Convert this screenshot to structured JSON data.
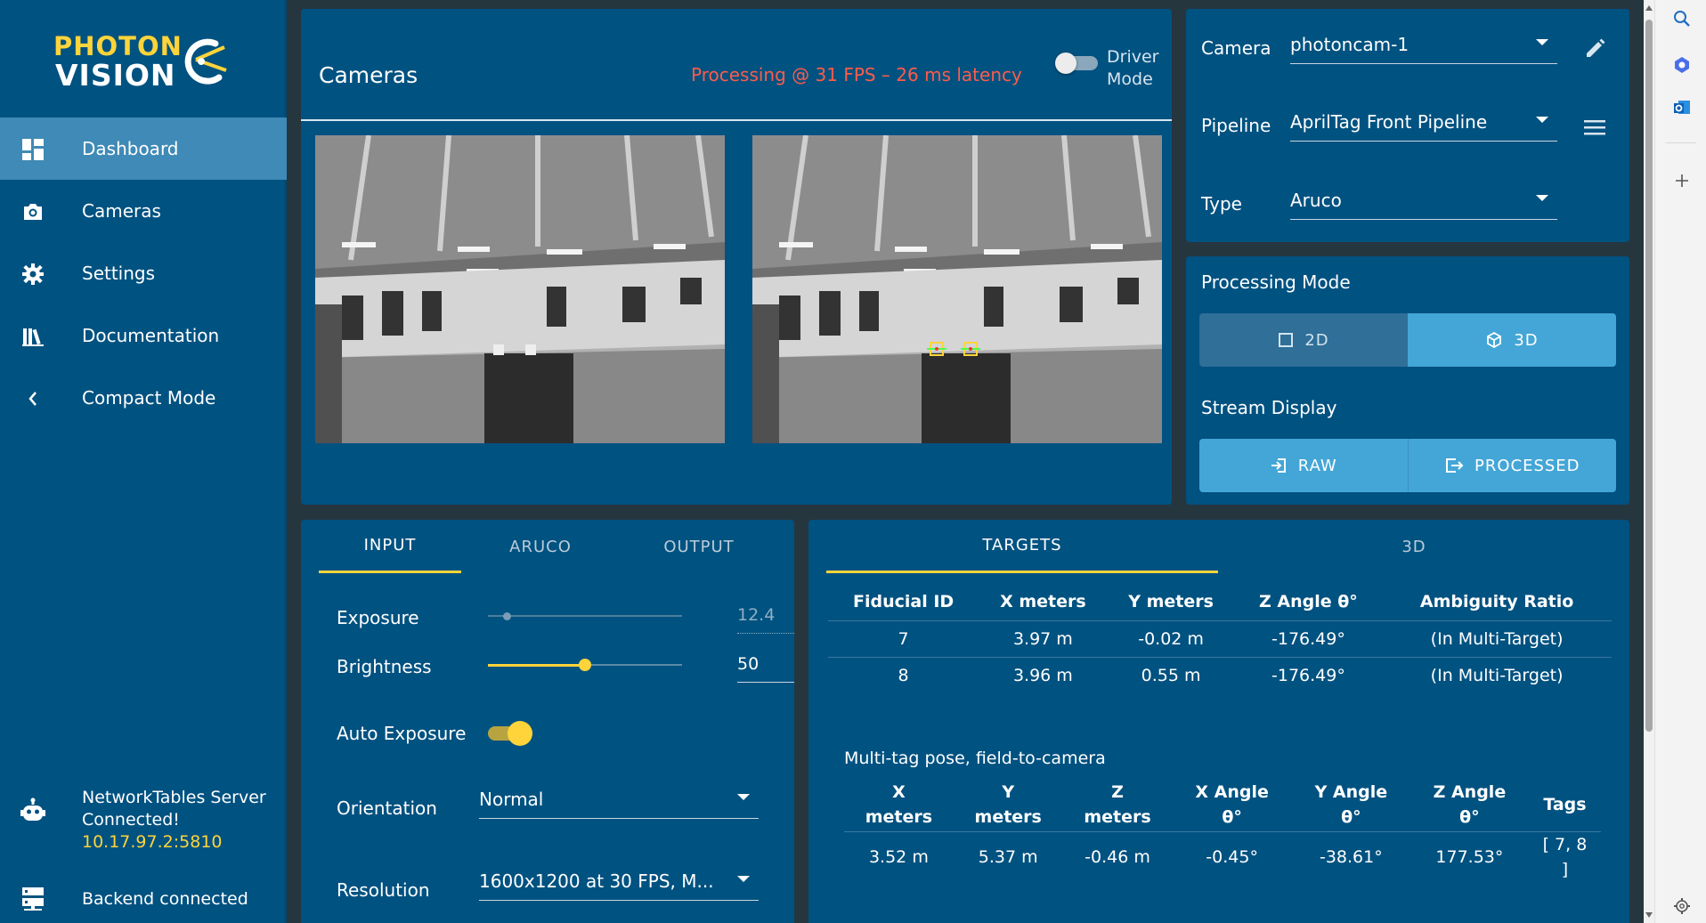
{
  "logo": {
    "line1": "PHOTON",
    "line2": "VISION"
  },
  "sidebar": {
    "items": [
      {
        "label": "Dashboard",
        "icon": "dashboard-icon"
      },
      {
        "label": "Cameras",
        "icon": "camera-icon"
      },
      {
        "label": "Settings",
        "icon": "gear-icon"
      },
      {
        "label": "Documentation",
        "icon": "library-icon"
      },
      {
        "label": "Compact Mode",
        "icon": "chevron-left-icon"
      }
    ],
    "nt_status": {
      "line1": "NetworkTables Server",
      "line2": "Connected!",
      "address": "10.17.97.2:5810"
    },
    "backend_status": "Backend connected"
  },
  "cameras_card": {
    "title": "Cameras",
    "fps_status": "Processing @ 31 FPS – 26 ms latency",
    "driver_mode_line1": "Driver",
    "driver_mode_line2": "Mode"
  },
  "config": {
    "camera_label": "Camera",
    "camera_value": "photoncam-1",
    "pipeline_label": "Pipeline",
    "pipeline_value": "AprilTag Front Pipeline",
    "type_label": "Type",
    "type_value": "Aruco"
  },
  "processing": {
    "title": "Processing Mode",
    "mode_2d": "2D",
    "mode_3d": "3D",
    "stream_title": "Stream Display",
    "raw": "RAW",
    "processed": "PROCESSED"
  },
  "input_tabs": [
    "INPUT",
    "ARUCO",
    "OUTPUT"
  ],
  "input": {
    "exposure_label": "Exposure",
    "exposure_value": "12.4",
    "exposure_level": 0.1,
    "brightness_label": "Brightness",
    "brightness_value": "50",
    "brightness_level": 0.5,
    "auto_exposure_label": "Auto Exposure",
    "orientation_label": "Orientation",
    "orientation_value": "Normal",
    "resolution_label": "Resolution",
    "resolution_value": "1600x1200 at 30 FPS, M..."
  },
  "target_tabs": [
    "TARGETS",
    "3D"
  ],
  "targets": {
    "headers": [
      "Fiducial ID",
      "X meters",
      "Y meters",
      "Z Angle θ°",
      "Ambiguity Ratio"
    ],
    "rows": [
      [
        "7",
        "3.97 m",
        "-0.02 m",
        "-176.49°",
        "(In Multi-Target)"
      ],
      [
        "8",
        "3.96 m",
        "0.55 m",
        "-176.49°",
        "(In Multi-Target)"
      ]
    ]
  },
  "multitag": {
    "title": "Multi-tag pose, field-to-camera",
    "headers": [
      [
        "X",
        "meters"
      ],
      [
        "Y",
        "meters"
      ],
      [
        "Z",
        "meters"
      ],
      [
        "X Angle",
        "θ°"
      ],
      [
        "Y Angle",
        "θ°"
      ],
      [
        "Z Angle",
        "θ°"
      ],
      [
        "Tags",
        ""
      ]
    ],
    "row": [
      "3.52 m",
      "5.37 m",
      "-0.46 m",
      "-0.45°",
      "-38.61°",
      "177.53°"
    ],
    "tags_line1": "[ 7, 8",
    "tags_line2": "]"
  },
  "colors": {
    "accent": "#ffd43a",
    "card": "#005281",
    "active": "#3f8ab6",
    "button": "#44a6d6",
    "error": "#ff5b4a"
  }
}
